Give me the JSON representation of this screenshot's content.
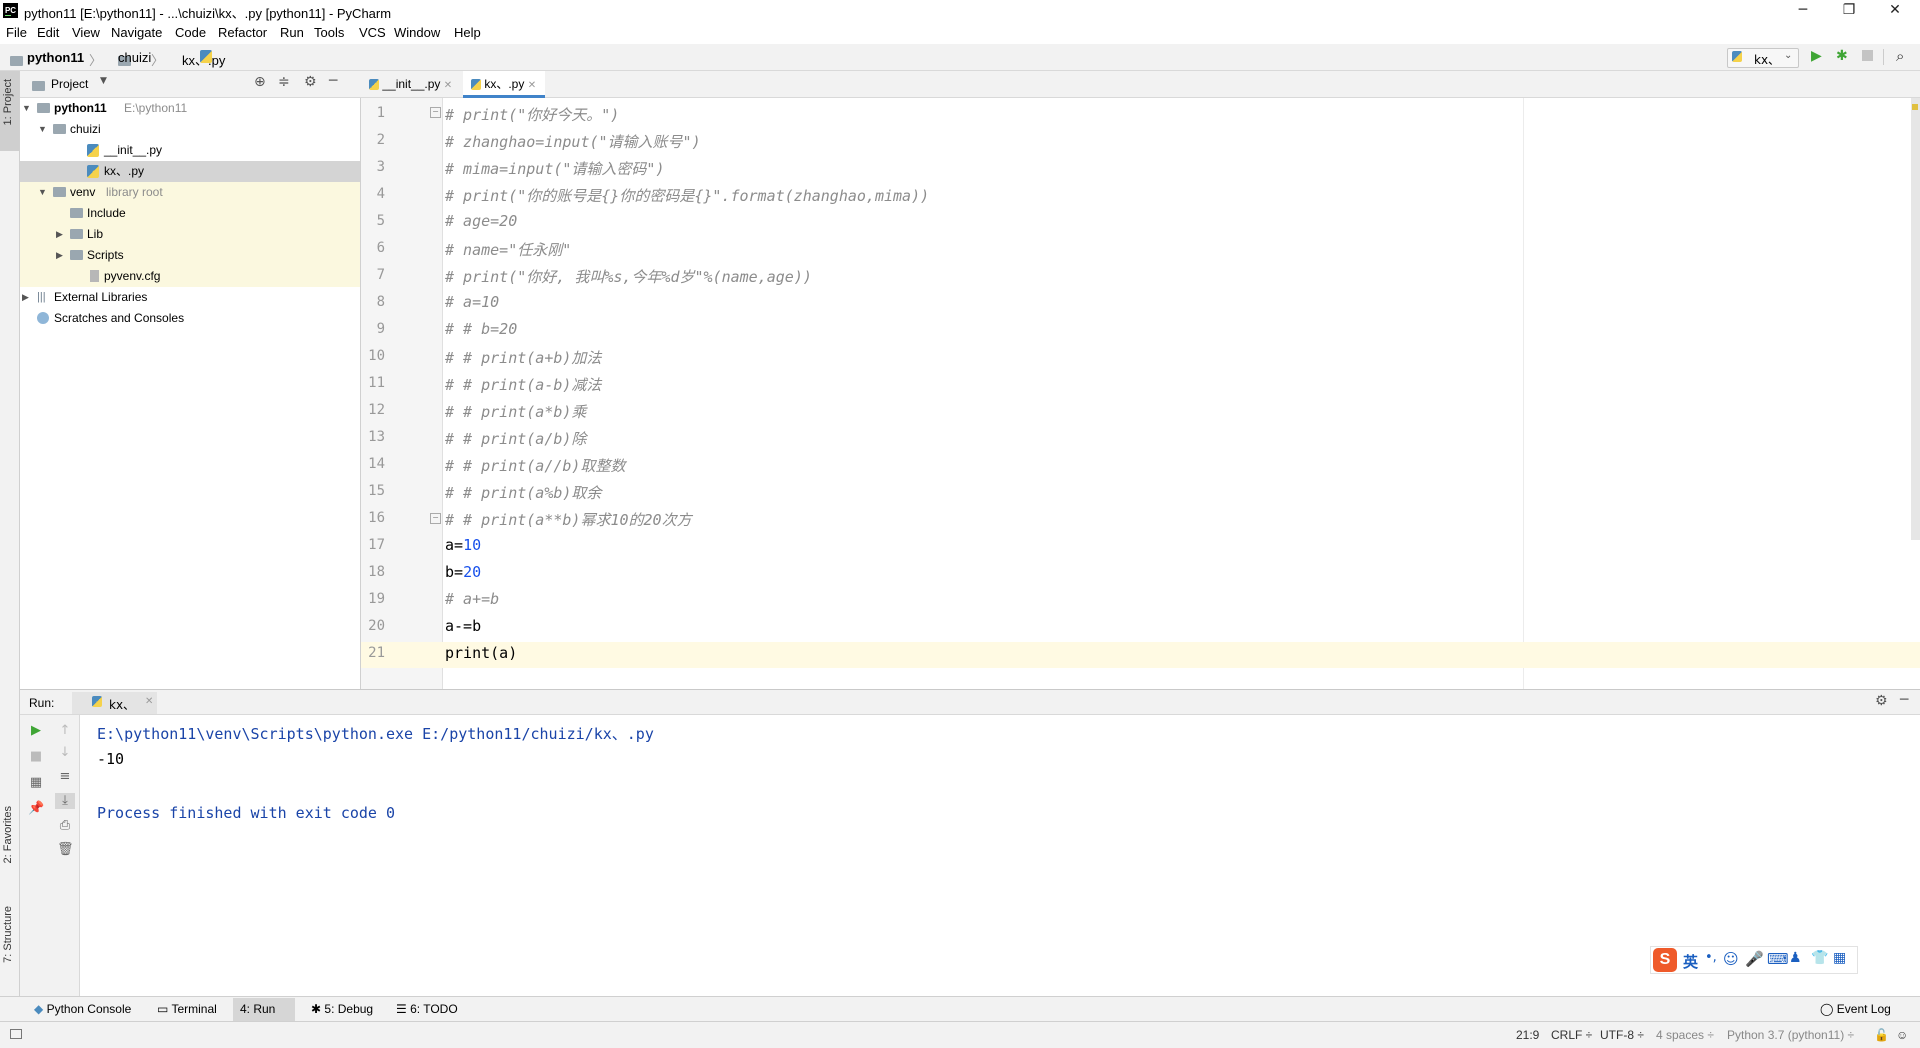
{
  "window": {
    "title": "python11 [E:\\python11] - ...\\chuizi\\kx、.py [python11] - PyCharm",
    "logo": "PC",
    "minimize_label": "─",
    "maximize_label": "❐",
    "close_label": "✕"
  },
  "menu": [
    "File",
    "Edit",
    "View",
    "Navigate",
    "Code",
    "Refactor",
    "Run",
    "Tools",
    "VCS",
    "Window",
    "Help"
  ],
  "breadcrumb": {
    "project": "python11",
    "folder": "chuizi",
    "file": "kx、.py"
  },
  "run_config": {
    "label": "kx、"
  },
  "side_tabs": {
    "project": "1: Project",
    "favorites": "2: Favorites",
    "structure": "7: Structure"
  },
  "project_panel": {
    "title": "Project",
    "tree": [
      {
        "label": "python11",
        "sub": "E:\\python11",
        "bold": true
      },
      {
        "label": "chuizi",
        "sub": ""
      },
      {
        "label": "__init__.py",
        "sub": ""
      },
      {
        "label": "kx、.py",
        "sub": ""
      },
      {
        "label": "venv",
        "sub": "library root"
      },
      {
        "label": "Include",
        "sub": ""
      },
      {
        "label": "Lib",
        "sub": ""
      },
      {
        "label": "Scripts",
        "sub": ""
      },
      {
        "label": "pyvenv.cfg",
        "sub": ""
      },
      {
        "label": "External Libraries",
        "sub": ""
      },
      {
        "label": "Scratches and Consoles",
        "sub": ""
      }
    ]
  },
  "editor_tabs": [
    {
      "label": "__init__.py",
      "active": false
    },
    {
      "label": "kx、.py",
      "active": true
    }
  ],
  "code_lines": [
    {
      "n": "1",
      "parts": [
        {
          "t": "# print(\"你好今天。\")",
          "c": "cmt"
        }
      ]
    },
    {
      "n": "2",
      "parts": [
        {
          "t": "# zhanghao=input(\"请输入账号\")",
          "c": "cmt"
        }
      ]
    },
    {
      "n": "3",
      "parts": [
        {
          "t": "# mima=input(\"请输入密码\")",
          "c": "cmt"
        }
      ]
    },
    {
      "n": "4",
      "parts": [
        {
          "t": "# print(\"你的账号是{}你的密码是{}\".format(zhanghao,mima))",
          "c": "cmt"
        }
      ]
    },
    {
      "n": "5",
      "parts": [
        {
          "t": "# age=20",
          "c": "cmt"
        }
      ]
    },
    {
      "n": "6",
      "parts": [
        {
          "t": "# name=\"任永刚\"",
          "c": "cmt"
        }
      ]
    },
    {
      "n": "7",
      "parts": [
        {
          "t": "# print(\"你好, 我叫%s,今年%d岁\"%(name,age))",
          "c": "cmt"
        }
      ]
    },
    {
      "n": "8",
      "parts": [
        {
          "t": "# a=10",
          "c": "cmt"
        }
      ]
    },
    {
      "n": "9",
      "parts": [
        {
          "t": "# # b=20",
          "c": "cmt"
        }
      ]
    },
    {
      "n": "10",
      "parts": [
        {
          "t": "# # print(a+b)加法",
          "c": "cmt"
        }
      ]
    },
    {
      "n": "11",
      "parts": [
        {
          "t": "# # print(a-b)减法",
          "c": "cmt"
        }
      ]
    },
    {
      "n": "12",
      "parts": [
        {
          "t": "# # print(a*b)乘",
          "c": "cmt"
        }
      ]
    },
    {
      "n": "13",
      "parts": [
        {
          "t": "# # print(a/b)除",
          "c": "cmt"
        }
      ]
    },
    {
      "n": "14",
      "parts": [
        {
          "t": "# # print(a//b)取整数",
          "c": "cmt"
        }
      ]
    },
    {
      "n": "15",
      "parts": [
        {
          "t": "# # print(a%b)取余",
          "c": "cmt"
        }
      ]
    },
    {
      "n": "16",
      "parts": [
        {
          "t": "# # print(a**b)幂求10的20次方",
          "c": "cmt"
        }
      ]
    },
    {
      "n": "17",
      "parts": [
        {
          "t": "a=",
          "c": ""
        },
        {
          "t": "10",
          "c": "num"
        }
      ]
    },
    {
      "n": "18",
      "parts": [
        {
          "t": "b=",
          "c": ""
        },
        {
          "t": "20",
          "c": "num"
        }
      ]
    },
    {
      "n": "19",
      "parts": [
        {
          "t": "# a+=b",
          "c": "cmt"
        }
      ]
    },
    {
      "n": "20",
      "parts": [
        {
          "t": "a-=b",
          "c": ""
        }
      ]
    },
    {
      "n": "21",
      "parts": [
        {
          "t": "print(a)",
          "c": ""
        }
      ]
    }
  ],
  "run_panel": {
    "label": "Run:",
    "tab": "kx、",
    "output": [
      {
        "text": "E:\\python11\\venv\\Scripts\\python.exe E:/python11/chuizi/kx、.py",
        "c": "blue"
      },
      {
        "text": "-10",
        "c": ""
      },
      {
        "text": "",
        "c": ""
      },
      {
        "text": "Process finished with exit code 0",
        "c": "blue"
      }
    ]
  },
  "bottom_tabs": [
    {
      "label": "Python Console"
    },
    {
      "label": "Terminal"
    },
    {
      "label": "4: Run"
    },
    {
      "label": "5: Debug"
    },
    {
      "label": "6: TODO"
    }
  ],
  "event_log": "Event Log",
  "status": {
    "position": "21:9",
    "line_sep": "CRLF ÷",
    "encoding": "UTF-8 ÷",
    "indent": "4 spaces ÷",
    "interpreter": "Python 3.7 (python11) ÷"
  },
  "ime": {
    "lang": "英"
  },
  "colors": {
    "accent": "#4083c9",
    "run_green": "#3fa535",
    "comment": "#8c8c8c",
    "number": "#1750eb",
    "output_blue": "#1a44a8",
    "current_line": "#fffae3"
  }
}
